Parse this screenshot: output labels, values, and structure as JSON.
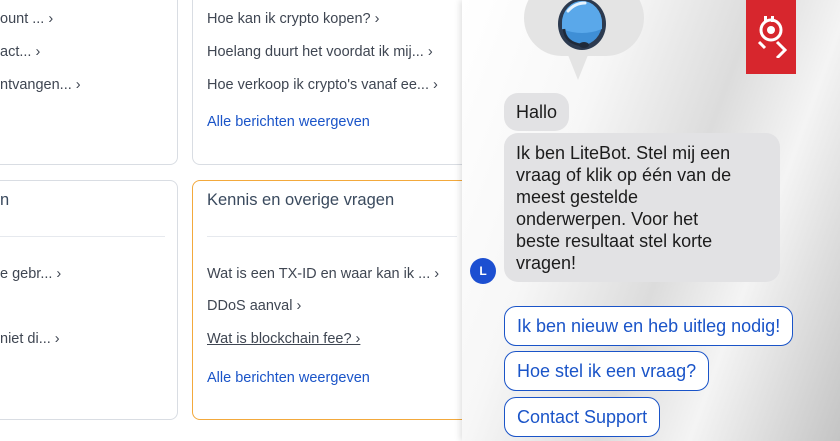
{
  "help_center": {
    "left_top_card": {
      "links": [
        "ount ... ›",
        "act... ›",
        "ntvangen... ›"
      ]
    },
    "top_card": {
      "links": [
        "Hoe kan ik crypto kopen? ›",
        "Hoelang duurt het voordat ik mij... ›",
        "Hoe verkoop ik crypto's vanaf ee... ›"
      ],
      "view_all": "Alle berichten weergeven"
    },
    "left_bottom_card": {
      "title": "n",
      "links": [
        "e gebr... ›",
        "niet di... ›"
      ]
    },
    "kennis_card": {
      "title": "Kennis en overige vragen",
      "links": [
        "Wat is een TX-ID en waar kan ik ... ›",
        "DDoS aanval ›",
        "Wat is blockchain fee? ›"
      ],
      "view_all": "Alle berichten weergeven"
    }
  },
  "chat": {
    "brand_color": "#d7262d",
    "accent_color": "#1a54c8",
    "greeting": "Hallo",
    "intro_lines": [
      "Ik ben LiteBot. Stel mij een",
      "vraag of klik op één van de",
      "meest gestelde",
      "onderwerpen. Voor het",
      "beste resultaat stel korte",
      "vragen!"
    ],
    "avatar_initial": "L",
    "quick_replies": [
      "Ik ben nieuw en heb uitleg nodig!",
      "Hoe stel ik een vraag?",
      "Contact Support"
    ]
  }
}
